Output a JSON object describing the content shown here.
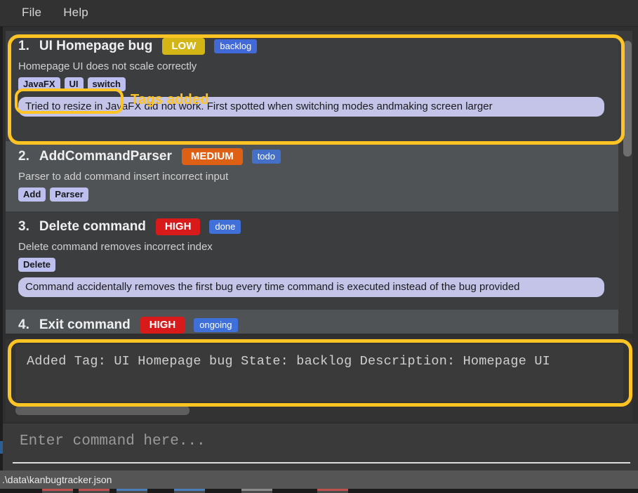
{
  "window": {
    "menu": [
      {
        "label": "File"
      },
      {
        "label": "Help"
      }
    ]
  },
  "bug_list": {
    "cards": [
      {
        "index": "1.",
        "title": "UI Homepage bug",
        "priority": "LOW",
        "state": "backlog",
        "description": "Homepage UI does not scale correctly",
        "tags": [
          "JavaFX",
          "UI",
          "switch"
        ],
        "note": "Tried to resize in JavaFX did not work. First spotted when switching modes andmaking screen larger"
      },
      {
        "index": "2.",
        "title": "AddCommandParser",
        "priority": "MEDIUM",
        "state": "todo",
        "description": "Parser to add command insert incorrect input",
        "tags": [
          "Add",
          "Parser"
        ],
        "note": ""
      },
      {
        "index": "3.",
        "title": "Delete command",
        "priority": "HIGH",
        "state": "done",
        "description": "Delete command removes incorrect index",
        "tags": [
          "Delete"
        ],
        "note": "Command accidentally removes the first bug every time command is executed instead of the bug provided"
      },
      {
        "index": "4.",
        "title": "Exit command",
        "priority": "HIGH",
        "state": "ongoing",
        "description": "",
        "tags": [],
        "note": ""
      }
    ]
  },
  "result": {
    "text": "Added Tag: UI Homepage bug State: backlog Description: Homepage UI"
  },
  "command": {
    "value": "",
    "placeholder": "Enter command here..."
  },
  "status": {
    "file_path": ".\\data\\kanbugtracker.json"
  },
  "annotations": {
    "tags_added_label": "Tags added"
  },
  "colors": {
    "annotation": "#fdc424",
    "priority_low": "#d4b516",
    "priority_medium": "#dd6015",
    "priority_high": "#d91a1a",
    "state_badge": "#4169d8",
    "tag_bg": "#bdbfee",
    "note_bg": "#c3c4e8",
    "panel_bg": "#3a3a3a",
    "card_dark": "#3c3d3f",
    "card_light": "#4f5356",
    "statusbar_bg": "#555555"
  }
}
